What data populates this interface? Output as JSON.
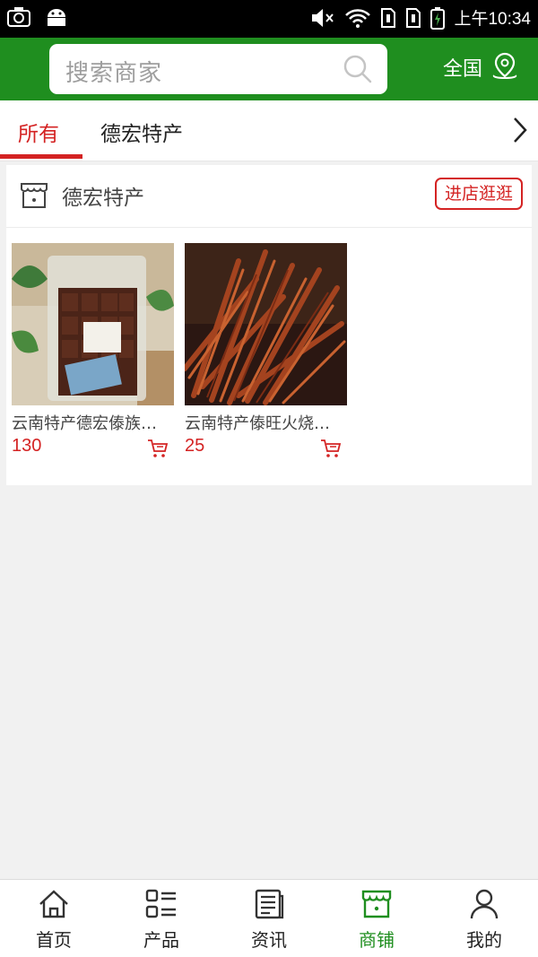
{
  "status_bar": {
    "time": "上午10:34"
  },
  "header": {
    "search_placeholder": "搜索商家",
    "region_label": "全国"
  },
  "tabs": [
    {
      "label": "所有",
      "active": true
    },
    {
      "label": "德宏特产",
      "active": false
    }
  ],
  "shop": {
    "name": "德宏特产",
    "enter_button": "进店逛逛",
    "products": [
      {
        "name": "云南特产德宏傣族牛肉干",
        "price": "130"
      },
      {
        "name": "云南特产傣旺火烧牛肉",
        "price": "25"
      }
    ]
  },
  "bottom_nav": [
    {
      "label": "首页",
      "icon": "home-icon",
      "active": false
    },
    {
      "label": "产品",
      "icon": "product-list-icon",
      "active": false
    },
    {
      "label": "资讯",
      "icon": "news-icon",
      "active": false
    },
    {
      "label": "商铺",
      "icon": "shop-icon",
      "active": true
    },
    {
      "label": "我的",
      "icon": "user-icon",
      "active": false
    }
  ],
  "colors": {
    "brand_green": "#1f8e1f",
    "accent_red": "#d42323"
  }
}
